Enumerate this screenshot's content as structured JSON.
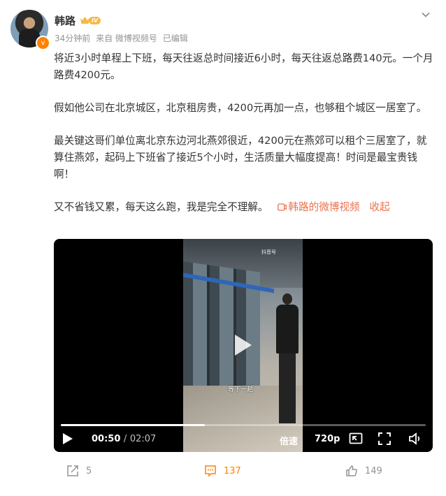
{
  "post": {
    "username": "韩路",
    "vip_level": "IV",
    "meta": {
      "time": "34分钟前",
      "source": "来自 微博视频号",
      "edited": "已编辑"
    },
    "paragraphs": [
      "将近3小时单程上下班，每天往返总时间接近6小时，每天往返总路费140元。一个月路费4200元。",
      "假如他公司在北京城区，北京租房贵，4200元再加一点，也够租个城区一居室了。",
      "最关键这哥们单位离北京东边河北燕郊很近，4200元在燕郊可以租个三居室了，就算住燕郊，起码上下班省了接近5个小时，生活质量大幅度提高！时间是最宝贵钱啊！"
    ],
    "last_paragraph": "又不省钱又累，每天这么跑，我是完全不理解。",
    "video_link": "韩路的微博视频",
    "collapse": "收起"
  },
  "video": {
    "watermark": "抖音号",
    "caption": "等下一趟",
    "current_time": "00:50",
    "separator": "/",
    "total_time": "02:07",
    "progress_fraction": 0.394,
    "speed_label": "倍速",
    "quality_label": "720p"
  },
  "actions": {
    "repost_count": "5",
    "comment_count": "137",
    "like_count": "149"
  },
  "colors": {
    "accent_orange": "#ff8200",
    "link": "#eb7350",
    "muted": "#939393"
  },
  "icons": [
    "chevron-down-icon",
    "video-link-icon",
    "play-icon",
    "pip-icon",
    "fullscreen-icon",
    "volume-icon",
    "repost-icon",
    "comment-icon",
    "like-icon"
  ]
}
